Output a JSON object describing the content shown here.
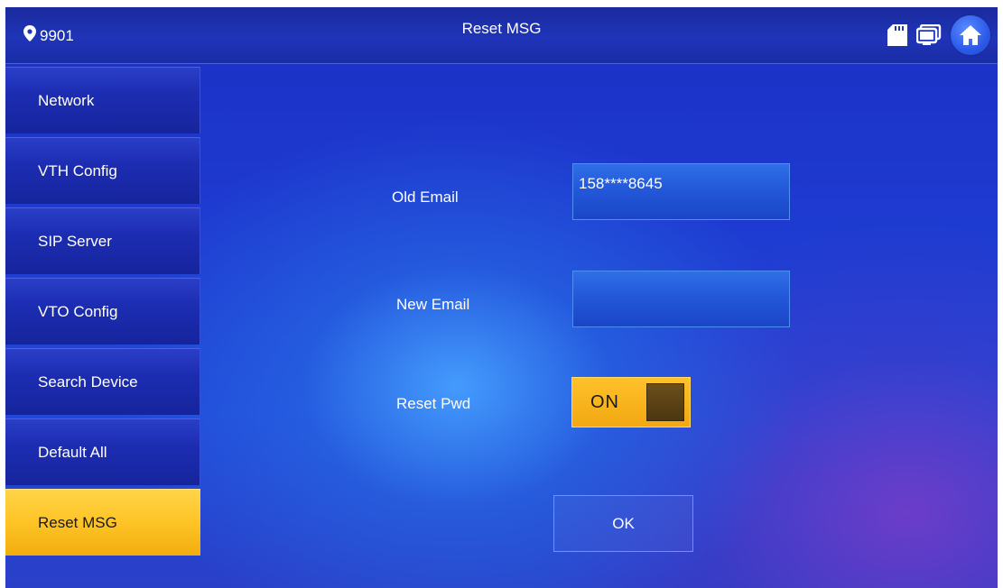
{
  "header": {
    "location_label": "9901",
    "title": "Reset MSG",
    "icons": [
      "location-pin-icon",
      "sd-card-icon",
      "monitor-icon",
      "home-icon"
    ]
  },
  "sidebar": {
    "items": [
      {
        "label": "Network",
        "active": false
      },
      {
        "label": "VTH Config",
        "active": false
      },
      {
        "label": "SIP Server",
        "active": false
      },
      {
        "label": "VTO Config",
        "active": false
      },
      {
        "label": "Search Device",
        "active": false
      },
      {
        "label": "Default All",
        "active": false
      },
      {
        "label": "Reset MSG",
        "active": true
      }
    ]
  },
  "form": {
    "old_email_label": "Old Email",
    "old_email_value": "158****8645",
    "new_email_label": "New Email",
    "new_email_value": "",
    "reset_pwd_label": "Reset Pwd",
    "reset_pwd_state": "ON",
    "ok_label": "OK"
  },
  "colors": {
    "accent_yellow": "#FFC629",
    "background_blue": "#1E3AD0",
    "field_blue": "#2256D8",
    "toggle_knob": "#5A4214"
  }
}
